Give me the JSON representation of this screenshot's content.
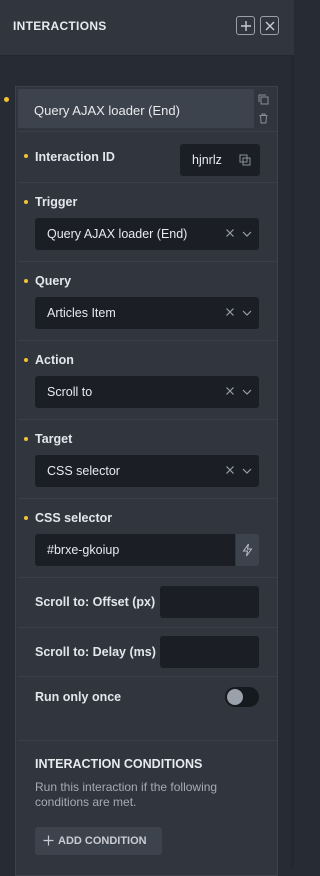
{
  "header": {
    "title": "INTERACTIONS"
  },
  "card": {
    "title": "Query AJAX loader (End)"
  },
  "interaction_id": {
    "label": "Interaction ID",
    "value": "hjnrlz"
  },
  "trigger": {
    "label": "Trigger",
    "value": "Query AJAX loader (End)"
  },
  "query": {
    "label": "Query",
    "value": "Articles Item"
  },
  "action": {
    "label": "Action",
    "value": "Scroll to"
  },
  "target": {
    "label": "Target",
    "value": "CSS selector"
  },
  "css_selector": {
    "label": "CSS selector",
    "value": "#brxe-gkoiup"
  },
  "offset": {
    "label": "Scroll to: Offset (px)",
    "value": ""
  },
  "delay": {
    "label": "Scroll to: Delay (ms)",
    "value": ""
  },
  "run_once": {
    "label": "Run only once",
    "enabled": false
  },
  "conditions": {
    "title": "INTERACTION CONDITIONS",
    "description": "Run this interaction if the following conditions are met.",
    "add_label": "ADD CONDITION"
  },
  "colors": {
    "accent_dot": "#f1c232",
    "input_bg": "#1b1e24",
    "panel_bg": "#30353e"
  }
}
